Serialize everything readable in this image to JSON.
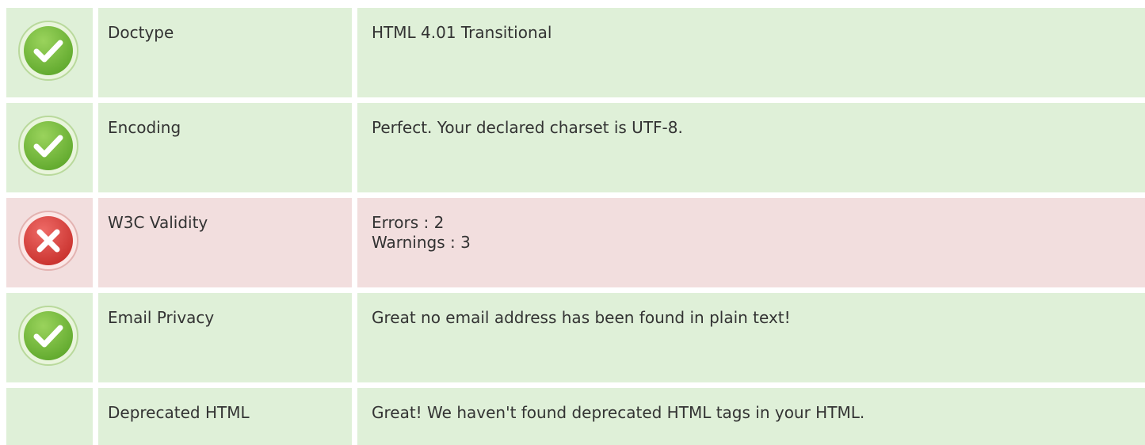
{
  "colors": {
    "ok_background": "#dff0d8",
    "error_background": "#f2dede",
    "ok_icon": "#7cc043",
    "error_icon": "#d9413f"
  },
  "rows": [
    {
      "status": "ok",
      "icon": "check-circle-icon",
      "name": "Doctype",
      "value_lines": [
        "HTML 4.01 Transitional"
      ]
    },
    {
      "status": "ok",
      "icon": "check-circle-icon",
      "name": "Encoding",
      "value_lines": [
        "Perfect. Your declared charset is UTF-8."
      ]
    },
    {
      "status": "error",
      "icon": "error-circle-icon",
      "name": "W3C Validity",
      "value_lines": [
        "Errors : 2",
        "Warnings : 3"
      ]
    },
    {
      "status": "ok",
      "icon": "check-circle-icon",
      "name": "Email Privacy",
      "value_lines": [
        "Great no email address has been found in plain text!"
      ]
    },
    {
      "status": "ok",
      "icon": "",
      "name": "Deprecated HTML",
      "value_lines": [
        "Great! We haven't found deprecated HTML tags in your HTML."
      ]
    }
  ]
}
